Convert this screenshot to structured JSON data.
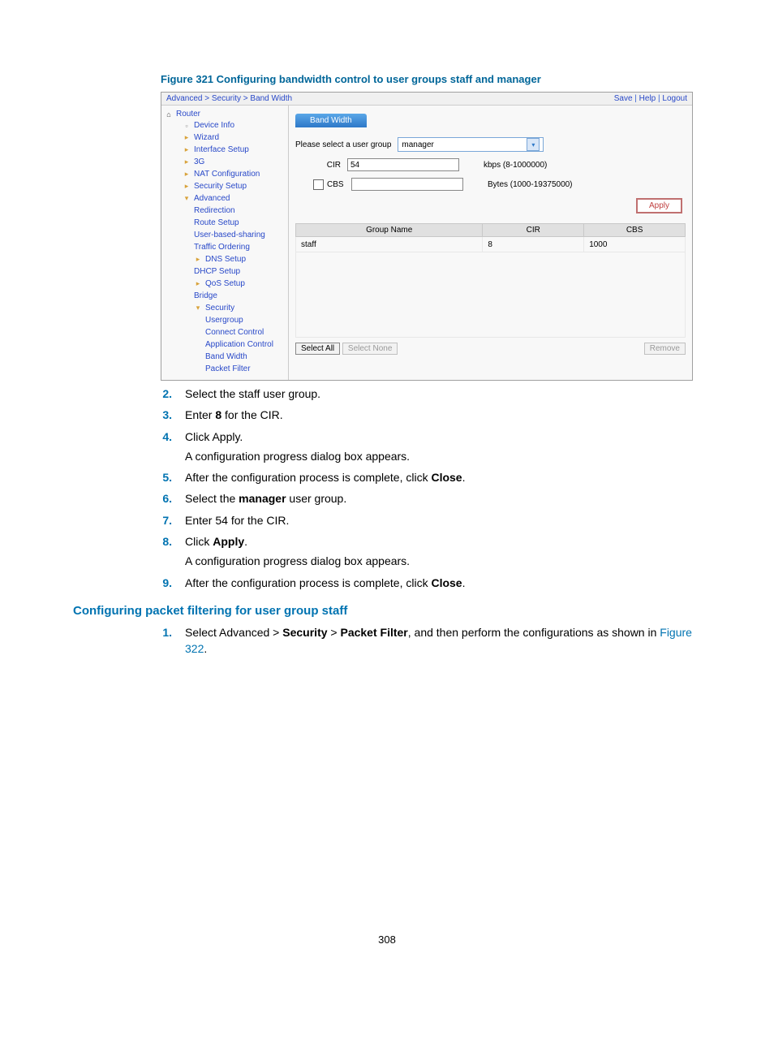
{
  "figure_title": "Figure 321 Configuring bandwidth control to user groups staff and manager",
  "sshot": {
    "breadcrumb": "Advanced > Security > Band Width",
    "toplinks": {
      "save": "Save",
      "help": "Help",
      "logout": "Logout"
    },
    "sidebar": {
      "root": "Router",
      "items": [
        "Device Info",
        "Wizard",
        "Interface Setup",
        "3G",
        "NAT Configuration",
        "Security Setup",
        "Advanced"
      ],
      "adv_children": [
        "Redirection",
        "Route Setup",
        "User-based-sharing",
        "Traffic Ordering",
        "DNS Setup",
        "DHCP Setup",
        "QoS Setup",
        "Bridge",
        "Security"
      ],
      "sec_children": [
        "Usergroup",
        "Connect Control",
        "Application Control",
        "Band Width",
        "Packet Filter"
      ]
    },
    "tab_label": "Band Width",
    "form": {
      "select_label": "Please select a user group",
      "select_value": "manager",
      "cir_label": "CIR",
      "cir_value": "54",
      "cir_hint": "kbps (8-1000000)",
      "cbs_label": "CBS",
      "cbs_value": "",
      "cbs_hint": "Bytes (1000-19375000)",
      "apply": "Apply"
    },
    "table": {
      "th": {
        "group": "Group Name",
        "cir": "CIR",
        "cbs": "CBS"
      },
      "rows": [
        {
          "group": "staff",
          "cir": "8",
          "cbs": "1000"
        }
      ],
      "select_all": "Select All",
      "select_none": "Select None",
      "remove": "Remove"
    }
  },
  "steps": {
    "s2": "Select the staff user group.",
    "s3_a": "Enter ",
    "s3_b": "8",
    "s3_c": " for the CIR.",
    "s4": "Click Apply.",
    "s4_f": "A configuration progress dialog box appears.",
    "s5_a": "After the configuration process is complete, click ",
    "s5_b": "Close",
    "s5_c": ".",
    "s6_a": "Select the ",
    "s6_b": "manager",
    "s6_c": " user group.",
    "s7": "Enter 54 for the CIR.",
    "s8_a": "Click ",
    "s8_b": "Apply",
    "s8_c": ".",
    "s8_f": "A configuration progress dialog box appears.",
    "s9_a": "After the configuration process is complete, click ",
    "s9_b": "Close",
    "s9_c": "."
  },
  "section2": "Configuring packet filtering for user group staff",
  "pf_step1_a": "Select Advanced > ",
  "pf_step1_b": "Security",
  "pf_step1_c": " > ",
  "pf_step1_d": "Packet Filter",
  "pf_step1_e": ", and then perform the configurations as shown in ",
  "pf_step1_f": "Figure 322",
  "pf_step1_g": ".",
  "nums": {
    "n2": "2.",
    "n3": "3.",
    "n4": "4.",
    "n5": "5.",
    "n6": "6.",
    "n7": "7.",
    "n8": "8.",
    "n9": "9.",
    "n1": "1."
  },
  "page_number": "308"
}
